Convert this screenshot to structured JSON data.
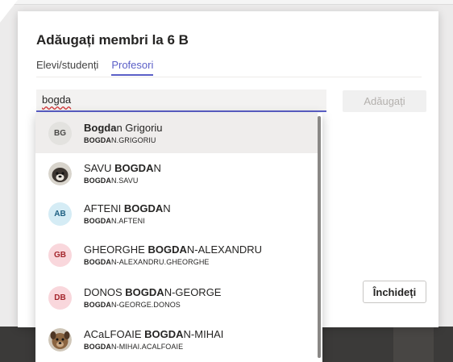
{
  "dialog": {
    "title": "Adăugați membri la 6 B",
    "tabs": [
      {
        "label": "Elevi/studenți",
        "active": false
      },
      {
        "label": "Profesori",
        "active": true
      }
    ],
    "search_value": "bogda",
    "add_label": "Adăugați",
    "close_label": "Închideți"
  },
  "results": [
    {
      "initials": "BG",
      "name_hl": "Bogda",
      "name_rest": "n Grigoriu",
      "user_hl": "BOGDA",
      "user_rest": "N.GRIGORIU",
      "avatar": "initials",
      "color": "grey"
    },
    {
      "name_pre": "SAVU ",
      "name_hl": "BOGDA",
      "name_rest": "N",
      "user_hl": "BOGDA",
      "user_rest": "N.SAVU",
      "avatar": "dog-photo-icon"
    },
    {
      "initials": "AB",
      "name_pre": "AFTENI ",
      "name_hl": "BOGDA",
      "name_rest": "N",
      "user_hl": "BOGDA",
      "user_rest": "N.AFTENI",
      "avatar": "initials",
      "color": "blue"
    },
    {
      "initials": "GB",
      "name_pre": "GHEORGHE ",
      "name_hl": "BOGDA",
      "name_rest": "N-ALEXANDRU",
      "user_hl": "BOGDA",
      "user_rest": "N-ALEXANDRU.GHEORGHE",
      "avatar": "initials",
      "color": "pink"
    },
    {
      "initials": "DB",
      "name_pre": "DONOS ",
      "name_hl": "BOGDA",
      "name_rest": "N-GEORGE",
      "user_hl": "BOGDA",
      "user_rest": "N-GEORGE.DONOS",
      "avatar": "initials",
      "color": "pink"
    },
    {
      "name_pre": "ACaLFOAIE ",
      "name_hl": "BOGDA",
      "name_rest": "N-MIHAI",
      "user_hl": "BOGDA",
      "user_rest": "N-MIHAI.ACALFOAIE",
      "avatar": "dog-photo-icon"
    }
  ]
}
